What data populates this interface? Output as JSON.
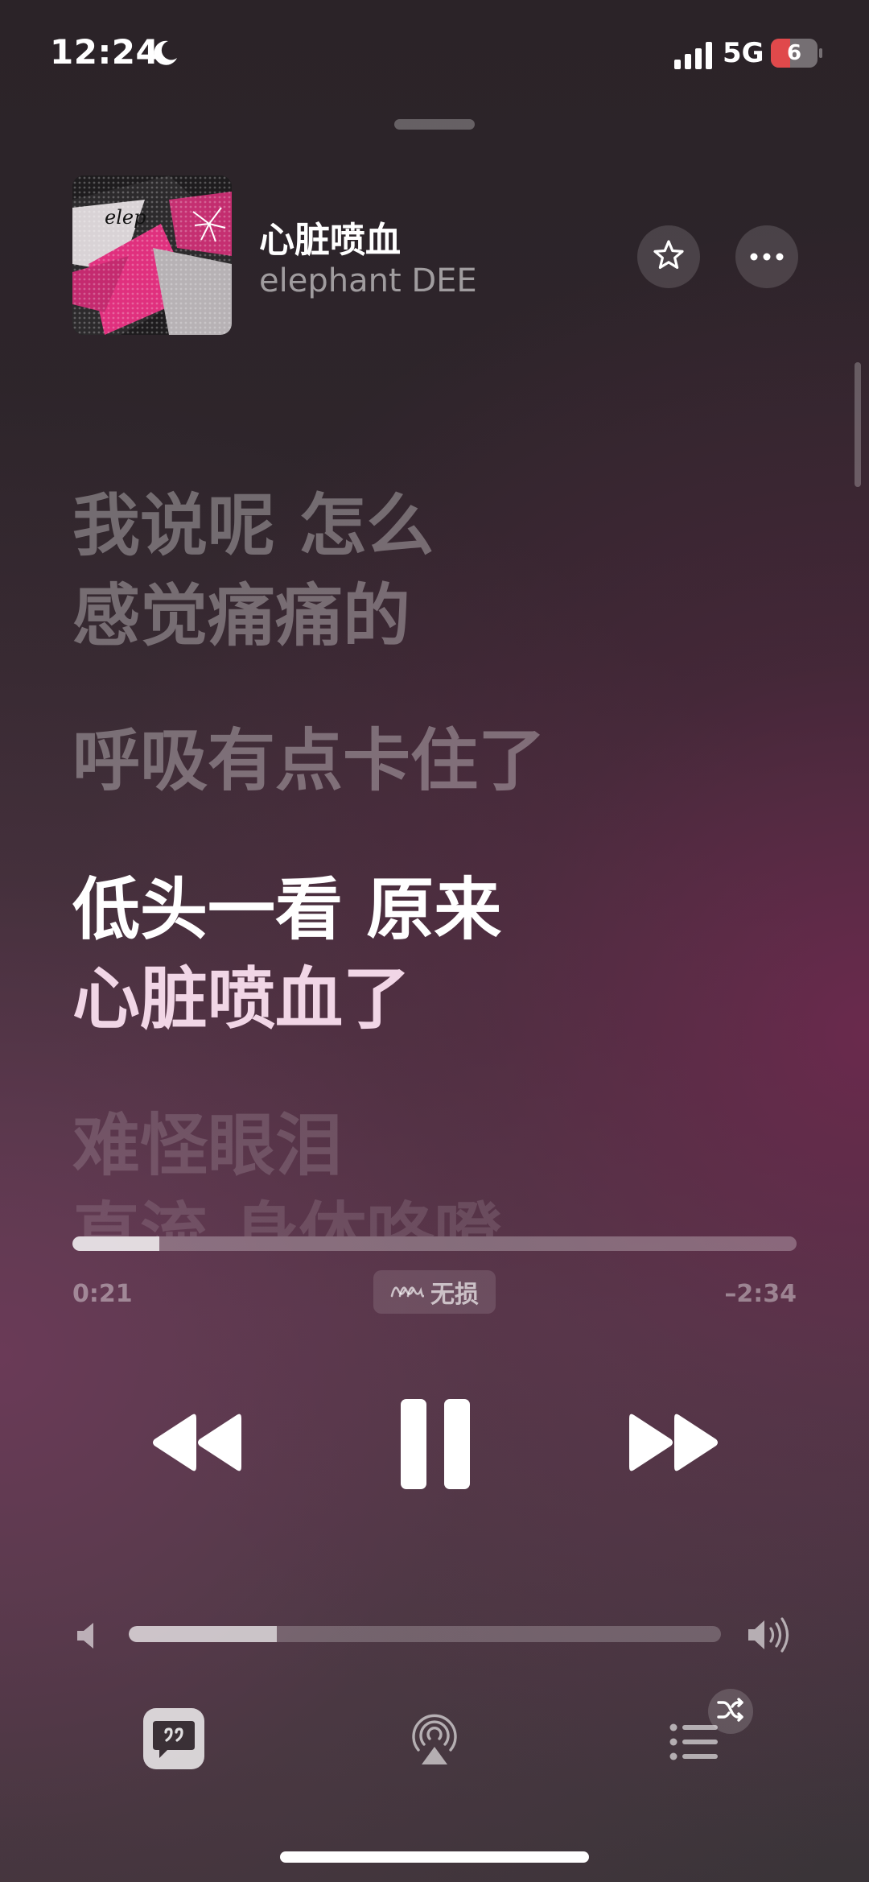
{
  "status_bar": {
    "time": "12:24",
    "network": "5G",
    "battery_level": "6",
    "icons": [
      "moon-icon",
      "signal-icon",
      "battery-icon"
    ]
  },
  "now_playing": {
    "title": "心脏喷血",
    "artist": "elephant DEE",
    "album_art_text": "elep"
  },
  "lyrics": {
    "lines": [
      "我说呢 怎么",
      "感觉痛痛的",
      "呼吸有点卡住了",
      "低头一看 原来",
      "心脏喷血了",
      "难怪眼泪",
      "直流 身体咯噔"
    ],
    "current_line_indices": [
      3,
      4
    ]
  },
  "playback": {
    "elapsed": "0:21",
    "remaining": "–2:34",
    "progress": 0.12,
    "quality_label": "无损",
    "state": "playing"
  },
  "volume": {
    "level": 0.25
  },
  "controls": {
    "icons": [
      "rewind-icon",
      "pause-icon",
      "forward-icon",
      "lyrics-icon",
      "airplay-icon",
      "queue-icon",
      "shuffle-icon",
      "star-icon",
      "more-icon"
    ]
  },
  "colors": {
    "accent_album": "#e0307e",
    "battery_low": "#e0494b"
  }
}
